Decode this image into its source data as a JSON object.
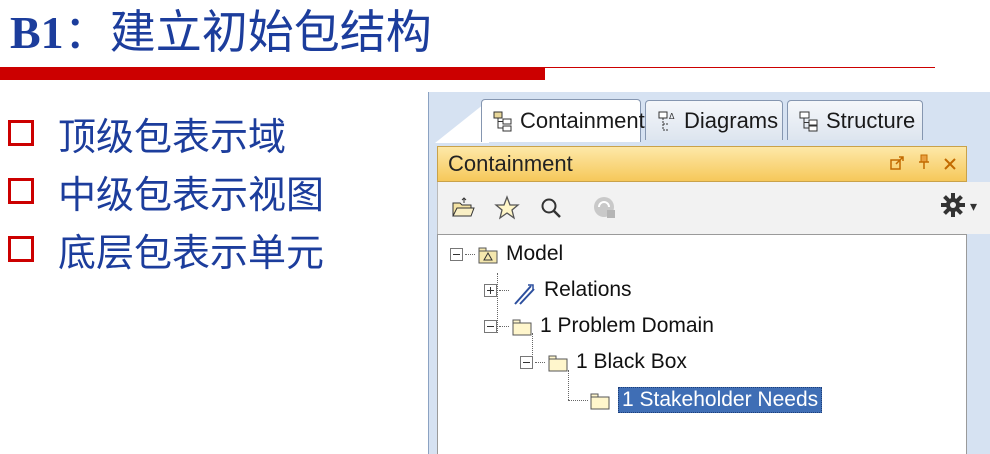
{
  "slide": {
    "title_prefix": "B1",
    "title_sep": "：",
    "title_text": "建立初始包结构",
    "bullets": [
      "顶级包表示域",
      "中级包表示视图",
      "底层包表示单元"
    ]
  },
  "panel": {
    "tabs": [
      {
        "label": "Containment",
        "icon": "containment-icon",
        "active": true
      },
      {
        "label": "Diagrams",
        "icon": "diagrams-icon",
        "active": false
      },
      {
        "label": "Structure",
        "icon": "structure-icon",
        "active": false
      }
    ],
    "view_title": "Containment",
    "header_controls": [
      "undock-icon",
      "pin-icon",
      "close-icon"
    ],
    "toolbar": [
      "open-project-icon",
      "favorite-star-icon",
      "search-icon",
      "sync-icon",
      "settings-gear-icon"
    ],
    "tree": {
      "model": "Model",
      "relations": "Relations",
      "problem_domain": "1 Problem Domain",
      "black_box": "1 Black Box",
      "stakeholder_needs": "1 Stakeholder Needs"
    }
  },
  "colors": {
    "title_blue": "#1c3d9c",
    "accent_red": "#cc0000",
    "header_gold": "#f6c85a",
    "selection_blue": "#3f6eb5"
  }
}
